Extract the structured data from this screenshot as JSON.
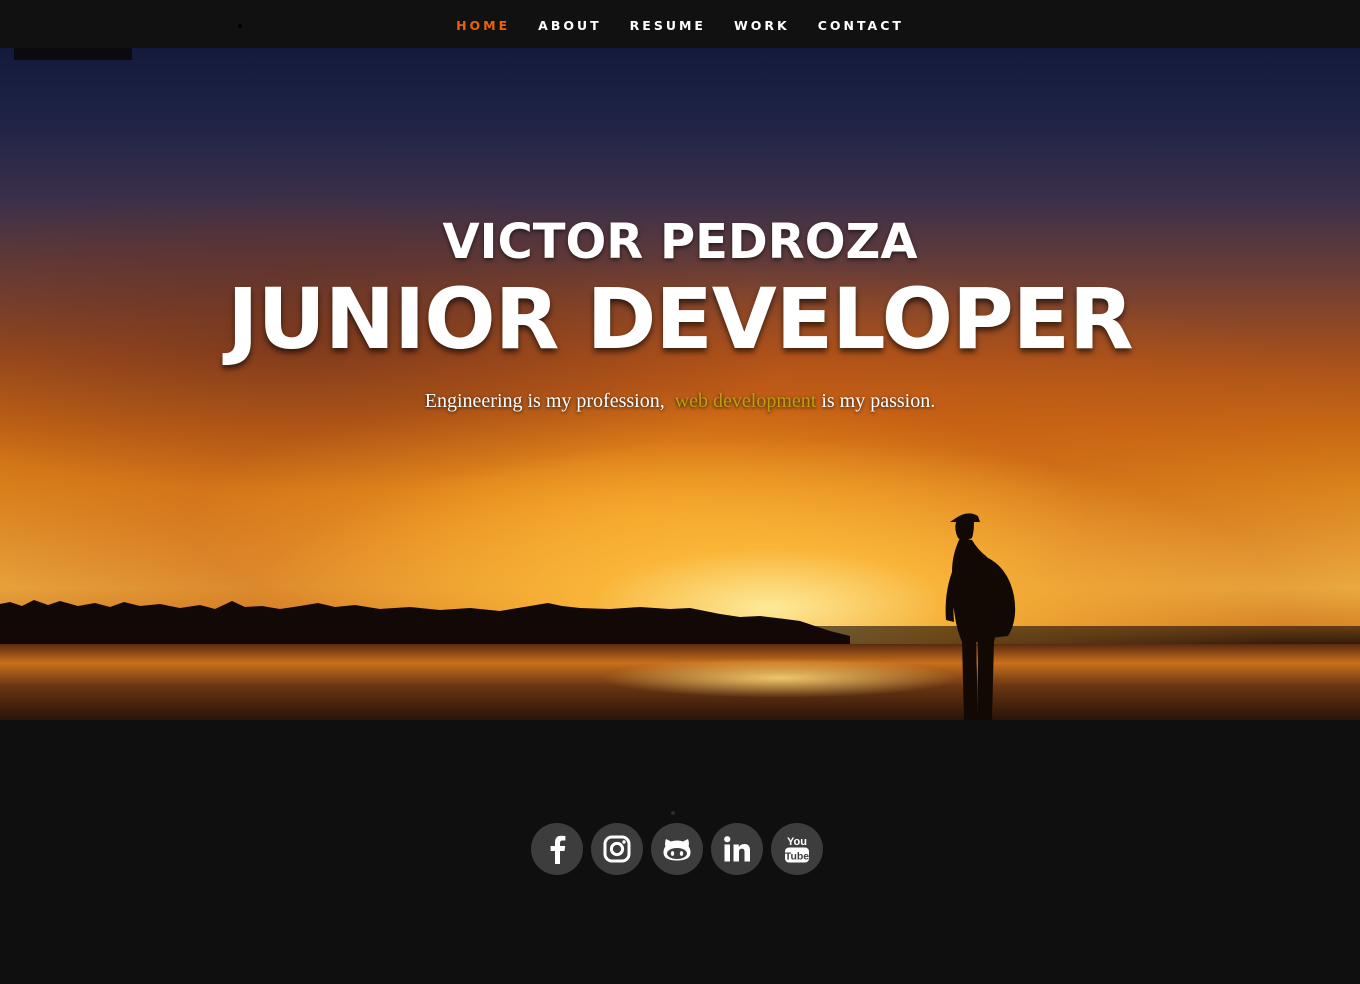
{
  "nav": {
    "items": [
      {
        "label": "HOME",
        "active": true
      },
      {
        "label": "ABOUT",
        "active": false
      },
      {
        "label": "RESUME",
        "active": false
      },
      {
        "label": "WORK",
        "active": false
      },
      {
        "label": "CONTACT",
        "active": false
      }
    ],
    "active_color": "#f06000"
  },
  "hero": {
    "name": "VICTOR PEDROZA",
    "title": "JUNIOR DEVELOPER",
    "tagline_before": "Engineering is my profession,",
    "tagline_highlight": "web development",
    "tagline_after": "is my passion.",
    "highlight_color": "#b8a014"
  },
  "social": [
    {
      "icon": "facebook-icon"
    },
    {
      "icon": "instagram-icon"
    },
    {
      "icon": "github-icon"
    },
    {
      "icon": "linkedin-icon"
    },
    {
      "icon": "youtube-icon",
      "glyph_top": "You",
      "glyph_bottom": "Tube"
    }
  ]
}
